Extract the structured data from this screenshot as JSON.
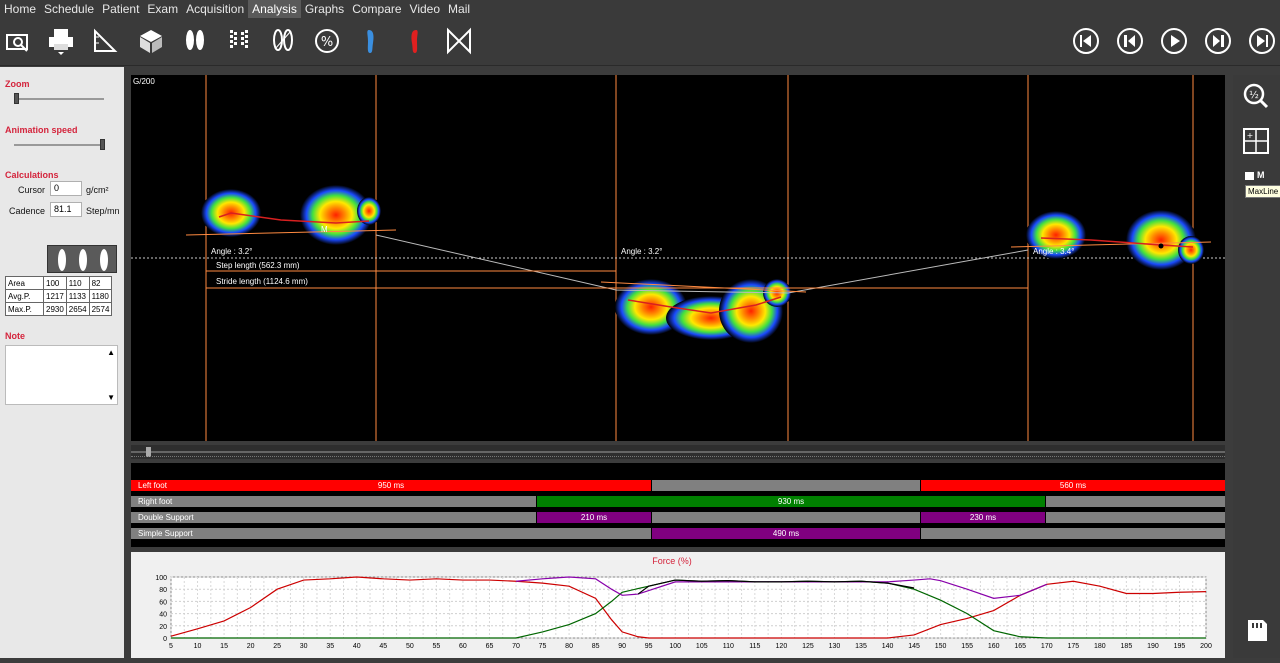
{
  "menu": [
    "Home",
    "Schedule",
    "Patient",
    "Exam",
    "Acquisition",
    "Analysis",
    "Graphs",
    "Compare",
    "Video",
    "Mail"
  ],
  "active_menu": "Analysis",
  "toolbar_icons": [
    "camera-search-icon",
    "printer-icon",
    "ruler-triangle-icon",
    "cube-icon",
    "feet-icon",
    "footprint-grid-icon",
    "footprint-lines-icon",
    "percent-icon",
    "left-foot-icon",
    "right-foot-icon",
    "hourglass-icon"
  ],
  "playback_icons": [
    "skip-first-icon",
    "step-back-icon",
    "play-icon",
    "step-forward-icon",
    "skip-last-icon"
  ],
  "left_panel": {
    "zoom_title": "Zoom",
    "anim_title": "Animation speed",
    "calc_title": "Calculations",
    "cursor_label": "Cursor",
    "cursor_value": "0",
    "cursor_unit": "g/cm²",
    "cadence_label": "Cadence",
    "cadence_value": "81.1",
    "cadence_unit": "Step/mn",
    "note_title": "Note",
    "stats": [
      [
        "Area",
        "100",
        "110",
        "82"
      ],
      [
        "Avg.P.",
        "1217",
        "1133",
        "1180"
      ],
      [
        "Max.P.",
        "2930",
        "2654",
        "2574"
      ]
    ]
  },
  "viewer": {
    "corner_label": "G/200",
    "angles": [
      "Angle : 3.2°",
      "Angle : 3.2°",
      "Angle : 3.4°"
    ],
    "step_length": "Step length (562.3 mm)",
    "stride_length": "Stride length (1124.6 mm)",
    "marker": "M"
  },
  "timeline": {
    "rows": [
      {
        "label": "Left foot",
        "segments": [
          {
            "text": "950 ms"
          },
          {
            "text": ""
          },
          {
            "text": "560 ms"
          }
        ]
      },
      {
        "label": "Right foot",
        "segments": [
          {
            "text": ""
          },
          {
            "text": "930 ms"
          },
          {
            "text": ""
          }
        ]
      },
      {
        "label": "Double Support",
        "segments": [
          {
            "text": ""
          },
          {
            "text": "210 ms"
          },
          {
            "text": ""
          },
          {
            "text": "230 ms"
          },
          {
            "text": ""
          }
        ]
      },
      {
        "label": "Simple Support",
        "segments": [
          {
            "text": ""
          },
          {
            "text": "490 ms"
          },
          {
            "text": ""
          }
        ]
      }
    ],
    "colors": {
      "red": "#ff0000",
      "gray": "#808080",
      "green": "#008000",
      "purple": "#800080"
    }
  },
  "right_panel": {
    "m_label": "M",
    "tooltip": "MaxLine"
  },
  "chart_data": {
    "type": "line",
    "title": "Force (%)",
    "xlim": [
      5,
      200
    ],
    "ylim": [
      0,
      100
    ],
    "x_ticks": [
      5,
      10,
      15,
      20,
      25,
      30,
      35,
      40,
      45,
      50,
      55,
      60,
      65,
      70,
      75,
      80,
      85,
      90,
      95,
      100,
      105,
      110,
      115,
      120,
      125,
      130,
      135,
      140,
      145,
      150,
      155,
      160,
      165,
      170,
      175,
      180,
      185,
      190,
      195,
      200
    ],
    "y_ticks": [
      0,
      20,
      40,
      60,
      80,
      100
    ],
    "series": [
      {
        "color": "#cc0000",
        "x": [
          5,
          10,
          15,
          20,
          25,
          30,
          35,
          40,
          45,
          50,
          55,
          60,
          65,
          70,
          75,
          80,
          85,
          88,
          90,
          93,
          95,
          100,
          140,
          145,
          150,
          155,
          160,
          165,
          170,
          175,
          180,
          185,
          190,
          195,
          200
        ],
        "y": [
          3,
          15,
          28,
          50,
          80,
          95,
          97,
          100,
          97,
          95,
          97,
          95,
          95,
          93,
          90,
          85,
          65,
          30,
          10,
          2,
          0,
          0,
          0,
          5,
          22,
          32,
          45,
          70,
          88,
          93,
          85,
          73,
          73,
          75,
          76
        ]
      },
      {
        "color": "#006600",
        "x": [
          5,
          70,
          75,
          80,
          85,
          88,
          90,
          95,
          100,
          105,
          110,
          115,
          120,
          125,
          130,
          135,
          140,
          145,
          150,
          155,
          160,
          165,
          170,
          200
        ],
        "y": [
          0,
          0,
          10,
          22,
          40,
          60,
          75,
          85,
          95,
          93,
          94,
          92,
          92,
          93,
          92,
          93,
          90,
          80,
          62,
          40,
          12,
          2,
          0,
          0
        ]
      },
      {
        "color": "#8800aa",
        "x": [
          70,
          75,
          80,
          85,
          88,
          90,
          93,
          100,
          140,
          145,
          148,
          150,
          155,
          160,
          165,
          170
        ],
        "y": [
          93,
          97,
          100,
          97,
          80,
          70,
          72,
          92,
          92,
          95,
          97,
          94,
          80,
          65,
          70,
          88
        ]
      },
      {
        "color": "#000000",
        "x": [
          93,
          95,
          100,
          105,
          110,
          115,
          120,
          125,
          130,
          135,
          140,
          145
        ],
        "y": [
          72,
          85,
          95,
          93,
          94,
          92,
          92,
          93,
          92,
          93,
          90,
          82
        ]
      }
    ]
  }
}
